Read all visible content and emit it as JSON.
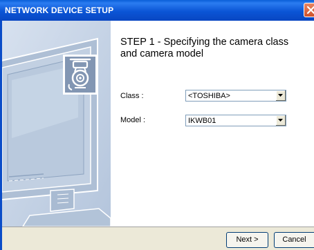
{
  "window": {
    "title": "NETWORK DEVICE SETUP",
    "close_icon": "close-icon"
  },
  "heading": {
    "line1": "STEP 1 -  Specifying the camera class",
    "line2": "and camera model"
  },
  "form": {
    "class_label": "Class :",
    "class_value": "<TOSHIBA>",
    "model_label": "Model :",
    "model_value": "IKWB01"
  },
  "buttons": {
    "next": "Next >",
    "cancel": "Cancel"
  },
  "icons": {
    "camera": "camera-icon",
    "monitor": "monitor-illustration",
    "dropdown": "chevron-down-icon"
  },
  "colors": {
    "titlebar": "#0a5fd8",
    "side_panel": "#c9d6e8",
    "dialog_bg": "#ece9d8"
  }
}
